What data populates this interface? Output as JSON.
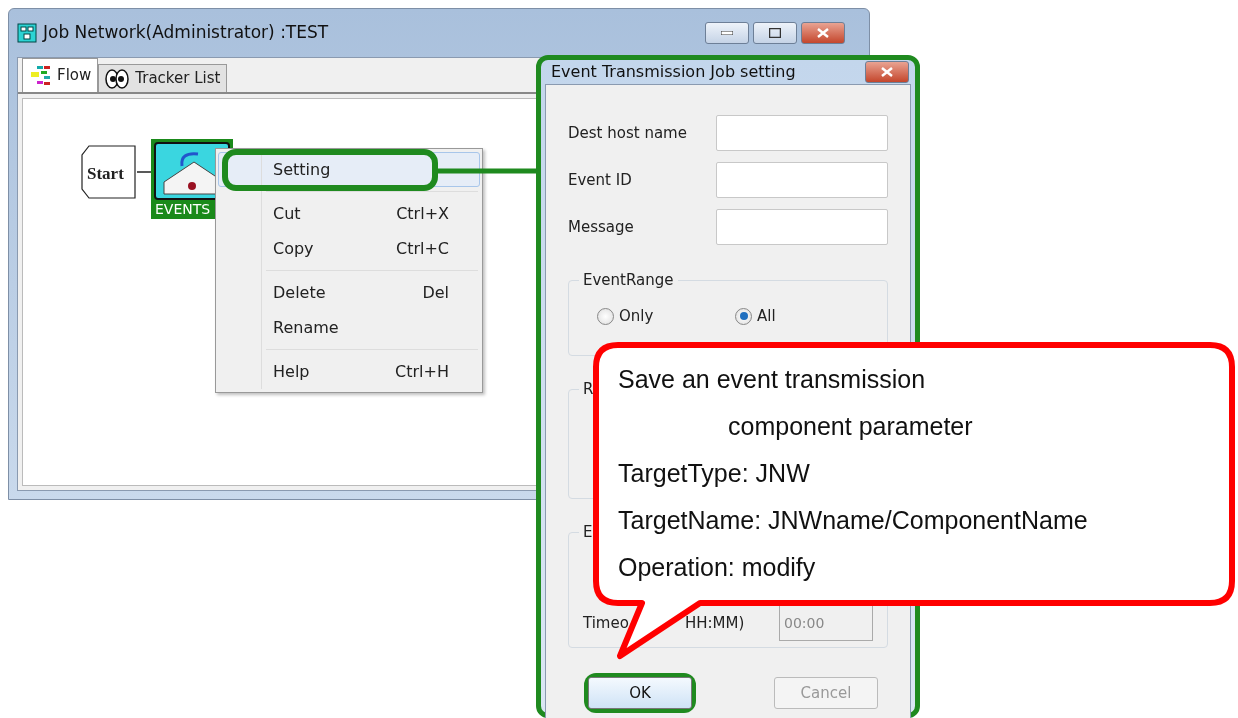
{
  "main_window": {
    "title": "Job Network(Administrator) :TEST",
    "tabs": [
      {
        "label": "Flow",
        "selected": true
      },
      {
        "label": "Tracker List",
        "selected": false
      }
    ],
    "flow": {
      "nodes": [
        {
          "kind": "start",
          "label": "Start"
        },
        {
          "kind": "job",
          "label": "EVENTS",
          "selected": true
        }
      ]
    }
  },
  "context_menu": {
    "groups": [
      [
        {
          "label": "Setting",
          "selected": true
        }
      ],
      [
        {
          "label": "Cut",
          "shortcut": "Ctrl+X",
          "selected": false
        },
        {
          "label": "Copy",
          "shortcut": "Ctrl+C",
          "selected": false
        }
      ],
      [
        {
          "label": "Delete",
          "shortcut": "Del",
          "selected": false
        },
        {
          "label": "Rename",
          "selected": false
        }
      ],
      [
        {
          "label": "Help",
          "shortcut": "Ctrl+H",
          "selected": false
        }
      ]
    ]
  },
  "dialog": {
    "title": "Event Transmission Job setting",
    "fields": [
      {
        "label": "Dest host name"
      },
      {
        "label": "Event ID"
      },
      {
        "label": "Message"
      }
    ],
    "event_range": {
      "legend": "EventRange",
      "options": [
        {
          "label": "Only",
          "selected": false
        },
        {
          "label": "All",
          "selected": true
        }
      ]
    },
    "group_2": {
      "legend": "R"
    },
    "group_3": {
      "legend": "E",
      "timeout_label_start": "Timeo",
      "timeout_label_end": "HH:MM)",
      "timeout_value": "00:00",
      "timeout_disabled": true
    },
    "buttons": [
      {
        "label": "OK",
        "disabled": false,
        "highlighted": true
      },
      {
        "label": "Cancel",
        "disabled": true,
        "highlighted": false
      }
    ]
  },
  "callout": {
    "lines": [
      {
        "text": "Save an event transmission",
        "indented": false
      },
      {
        "text": "component parameter",
        "indented": true
      },
      {
        "text": "TargetType: JNW",
        "indented": false
      },
      {
        "text": "TargetName: JNWname/ComponentName",
        "indented": false
      },
      {
        "text": "Operation: modify",
        "indented": false
      }
    ]
  }
}
